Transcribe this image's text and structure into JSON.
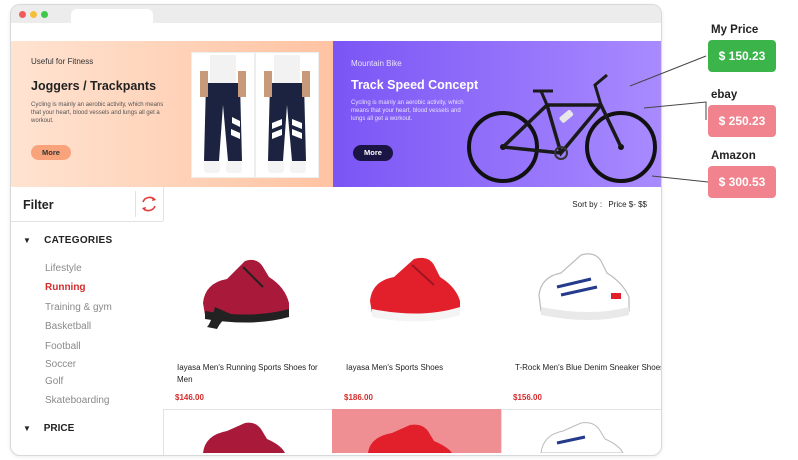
{
  "banner_left": {
    "kicker": "Useful for Fitness",
    "title": "Joggers / Trackpants",
    "description": "Cycling is mainly an aerobic activity, which means that your heart, blood vessels and lungs all get a workout.",
    "button": "More"
  },
  "banner_right": {
    "kicker": "Mountain Bike",
    "title": "Track Speed Concept",
    "description": "Cycling is mainly an aerobic activity, which means that your heart, blood vessels and lungs all get a workout.",
    "button": "More"
  },
  "filter": {
    "title": "Filter",
    "refresh_icon": "refresh-icon",
    "categories_label": "CATEGORIES",
    "categories": [
      "Lifestyle",
      "Running",
      "Training & gym",
      "Basketball",
      "Football",
      "Soccer",
      "Golf",
      "Skateboarding"
    ],
    "active_category": "Running",
    "price_label": "PRICE"
  },
  "sort": {
    "label": "Sort by :",
    "value": "Price $- $$"
  },
  "products": [
    {
      "name": "Iayasa Men's Running Sports Shoes for Men",
      "price": "$146.00",
      "color": "#a8193a"
    },
    {
      "name": "Iayasa Men's Sports Shoes",
      "price": "$186.00",
      "color": "#e2202c"
    },
    {
      "name": "T-Rock Men's Blue Denim Sneaker Shoes",
      "price": "$156.00",
      "color": "#ffffff"
    }
  ],
  "comparison": [
    {
      "store": "My Price",
      "price": "$ 150.23",
      "color": "#3bb54a"
    },
    {
      "store": "ebay",
      "price": "$ 250.23",
      "color": "#f1838e"
    },
    {
      "store": "Amazon",
      "price": "$ 300.53",
      "color": "#f1838e"
    }
  ],
  "colors": {
    "accent_red": "#d42c2c",
    "banner_purple": "#7b55f5",
    "banner_peach": "#ffc3a2"
  }
}
